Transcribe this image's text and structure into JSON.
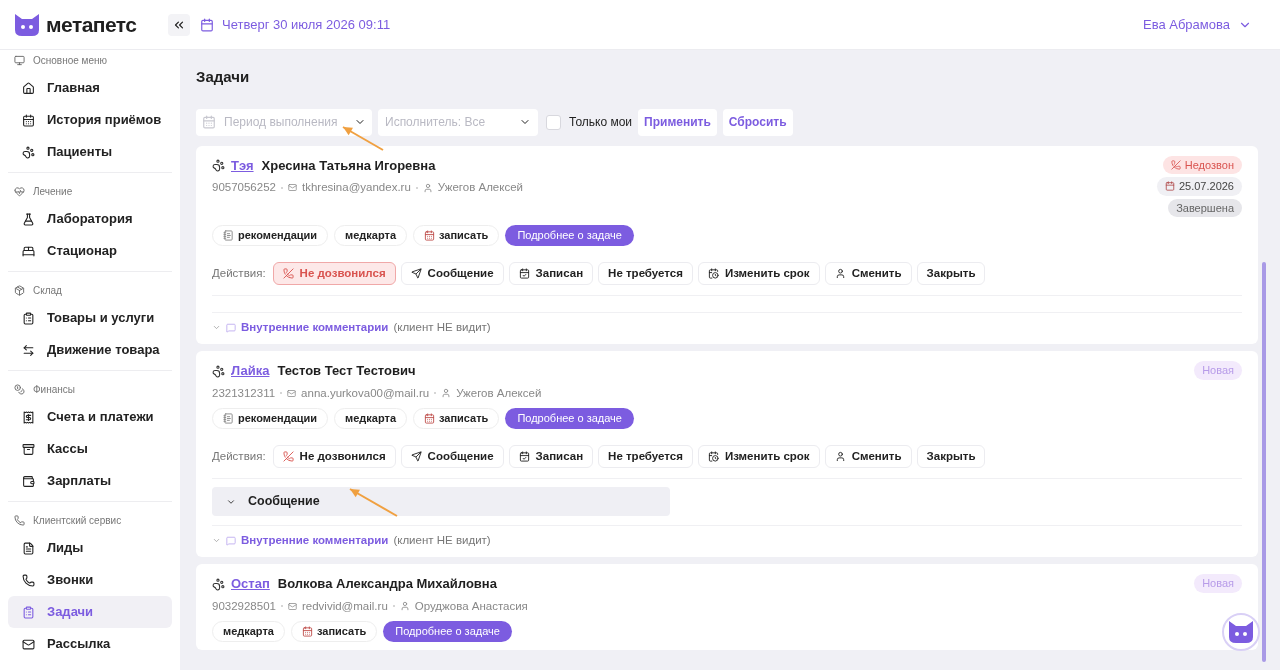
{
  "header": {
    "logo": "метапетс",
    "date": "Четверг 30 июля 2026 09:11",
    "user": "Ева Абрамова"
  },
  "sidebar": {
    "sections": [
      {
        "title": "Основное меню",
        "items": [
          {
            "label": "Главная",
            "selected": false
          },
          {
            "label": "История приёмов",
            "selected": false
          },
          {
            "label": "Пациенты",
            "selected": false
          }
        ]
      },
      {
        "title": "Лечение",
        "items": [
          {
            "label": "Лаборатория",
            "selected": false
          },
          {
            "label": "Стационар",
            "selected": false
          }
        ]
      },
      {
        "title": "Склад",
        "items": [
          {
            "label": "Товары и услуги",
            "selected": false
          },
          {
            "label": "Движение товара",
            "selected": false
          }
        ]
      },
      {
        "title": "Финансы",
        "items": [
          {
            "label": "Счета и платежи",
            "selected": false
          },
          {
            "label": "Кассы",
            "selected": false
          },
          {
            "label": "Зарплаты",
            "selected": false
          }
        ]
      },
      {
        "title": "Клиентский сервис",
        "items": [
          {
            "label": "Лиды",
            "selected": false
          },
          {
            "label": "Звонки",
            "selected": false
          },
          {
            "label": "Задачи",
            "selected": true
          },
          {
            "label": "Рассылка",
            "selected": false
          }
        ]
      }
    ]
  },
  "page": {
    "title": "Задачи"
  },
  "filters": {
    "period": {
      "placeholder": "Период выполнения"
    },
    "executor": {
      "label": "Исполнитель:",
      "value": "Все"
    },
    "only_mine": {
      "label": "Только мои",
      "checked": false
    },
    "buttons": [
      "Применить",
      "Сбросить"
    ]
  },
  "tasks": [
    {
      "pet": "Тэя",
      "owner": "Хресина Татьяна Игоревна",
      "phone": "9057056252",
      "email": "tkhresina@yandex.ru",
      "assignee": "Ужегов Алексей",
      "badges": [
        {
          "label": "Недозвон",
          "kind": "missed"
        },
        {
          "label": "25.07.2026",
          "kind": "date"
        },
        {
          "label": "Завершена",
          "kind": "done"
        }
      ],
      "tags": [
        {
          "label": "рекомендации",
          "kind": "notes"
        },
        {
          "label": "медкарта",
          "kind": "plain"
        },
        {
          "label": "записать",
          "kind": "calendar"
        },
        {
          "label": "Подробнее о задаче",
          "kind": "primary"
        }
      ],
      "actions": {
        "label": "Действия:",
        "items": [
          {
            "label": "Не дозвонился",
            "active": true
          },
          {
            "label": "Сообщение",
            "active": false
          },
          {
            "label": "Записан",
            "active": false
          },
          {
            "label": "Не требуется",
            "active": false
          },
          {
            "label": "Изменить срок",
            "active": false
          },
          {
            "label": "Сменить",
            "active": false
          },
          {
            "label": "Закрыть",
            "active": false
          }
        ]
      },
      "comments": {
        "label": "Внутренние комментарии",
        "note": "(клиент НЕ видит)"
      }
    },
    {
      "pet": "Лайка",
      "owner": "Тестов Тест Тестович",
      "phone": "2321312311",
      "email": "anna.yurkova00@mail.ru",
      "assignee": "Ужегов Алексей",
      "badges": [
        {
          "label": "Новая",
          "kind": "new"
        }
      ],
      "tags": [
        {
          "label": "рекомендации",
          "kind": "notes"
        },
        {
          "label": "медкарта",
          "kind": "plain"
        },
        {
          "label": "записать",
          "kind": "calendar"
        },
        {
          "label": "Подробнее о задаче",
          "kind": "primary"
        }
      ],
      "actions": {
        "label": "Действия:",
        "items": [
          {
            "label": "Не дозвонился",
            "active": false
          },
          {
            "label": "Сообщение",
            "active": false
          },
          {
            "label": "Записан",
            "active": false
          },
          {
            "label": "Не требуется",
            "active": false
          },
          {
            "label": "Изменить срок",
            "active": false
          },
          {
            "label": "Сменить",
            "active": false
          },
          {
            "label": "Закрыть",
            "active": false
          }
        ]
      },
      "message_panel": {
        "label": "Сообщение",
        "expanded": false
      },
      "comments": {
        "label": "Внутренние комментарии",
        "note": "(клиент НЕ видит)"
      }
    },
    {
      "pet": "Остап",
      "owner": "Волкова Александра Михайловна",
      "phone": "9032928501",
      "email": "redvivid@mail.ru",
      "assignee": "Оруджова Анастасия",
      "badges": [
        {
          "label": "Новая",
          "kind": "new"
        }
      ],
      "tags": [
        {
          "label": "медкарта",
          "kind": "plain"
        },
        {
          "label": "записать",
          "kind": "calendar"
        },
        {
          "label": "Подробнее о задаче",
          "kind": "primary"
        }
      ]
    }
  ]
}
